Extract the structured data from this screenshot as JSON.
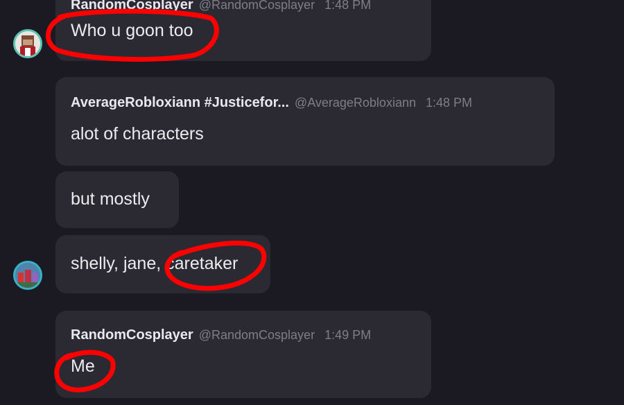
{
  "messages": [
    {
      "author": "RandomCosplayer",
      "handle": "@RandomCosplayer",
      "time": "1:48 PM",
      "text": "Who u goon too"
    },
    {
      "author": "AverageRobloxiann #Justicefor...",
      "handle": "@AverageRobloxiann",
      "time": "1:48 PM",
      "text": "alot of characters"
    },
    {
      "text": "but mostly"
    },
    {
      "text": "shelly, jane, caretaker"
    },
    {
      "author": "RandomCosplayer",
      "handle": "@RandomCosplayer",
      "time": "1:49 PM",
      "text": "Me"
    }
  ],
  "colors": {
    "background": "#1b1a22",
    "bubble": "#2b2a33",
    "annotation": "#ff0000",
    "muted_text": "#7f7d89"
  }
}
